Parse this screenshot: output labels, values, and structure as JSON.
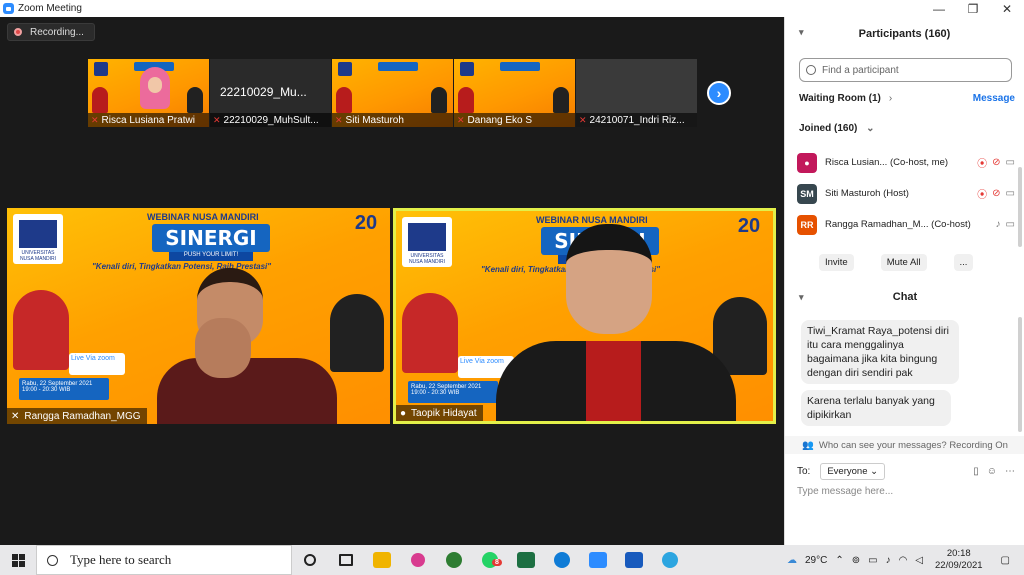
{
  "window": {
    "title": "Zoom Meeting",
    "controls": [
      "—",
      "❐",
      "✕"
    ]
  },
  "recording": {
    "label": "Recording..."
  },
  "thumbnails": [
    {
      "name": "Risca Lusiana Pratwi",
      "kind": "poster-hijab"
    },
    {
      "name": "22210029_MuhSult...",
      "kind": "plain",
      "center_text": "22210029_Mu..."
    },
    {
      "name": "Siti Masturoh",
      "kind": "poster"
    },
    {
      "name": "Danang Eko S",
      "kind": "poster"
    },
    {
      "name": "24210071_Indri Riz...",
      "kind": "dark"
    }
  ],
  "videos": [
    {
      "name": "Rangga Ramadhan_MGG"
    },
    {
      "name": "Taopik Hidayat"
    }
  ],
  "poster": {
    "webinar": "WEBINAR NUSA MANDIRI",
    "title": "SINERGI",
    "push": "PUSH YOUR LIMIT!",
    "tagline": "\"Kenali diri, Tingkatkan Potensi, Raih Prestasi\"",
    "anniv": "20",
    "live": "Live Via zoom",
    "date": "Rabu, 22 September 2021 19:00 - 20:30 WIB"
  },
  "participants_panel": {
    "title": "Participants (160)",
    "search_placeholder": "Find a participant",
    "waiting_room": "Waiting Room (1)",
    "message_label": "Message",
    "joined": "Joined (160)",
    "people": [
      {
        "initials": "",
        "name": "Risca Lusian...",
        "role": "(Co-host, me)",
        "color": "#c2185b"
      },
      {
        "initials": "SM",
        "name": "Siti Masturoh (Host)",
        "role": "",
        "color": "#37474f"
      },
      {
        "initials": "RR",
        "name": "Rangga Ramadhan_M...",
        "role": "(Co-host)",
        "color": "#e65100"
      }
    ],
    "buttons": {
      "invite": "Invite",
      "mute_all": "Mute All",
      "more": "..."
    }
  },
  "chat": {
    "title": "Chat",
    "messages": [
      "Tiwi_Kramat Raya_potensi diri itu cara menggalinya bagaimana jika kita bingung dengan diri sendiri pak",
      "Karena terlalu banyak yang dipikirkan"
    ],
    "visibility": "Who can see your messages? Recording On",
    "to_label": "To:",
    "recipient": "Everyone",
    "placeholder": "Type message here..."
  },
  "taskbar": {
    "search_placeholder": "Type here to search",
    "weather": "29°C",
    "time": "20:18",
    "date": "22/09/2021",
    "badge": "8",
    "app_colors": [
      "#f0b400",
      "#d83b8f",
      "#2e7d32",
      "#25d366",
      "#1d6f42",
      "#0f7bd6",
      "#2d8cff",
      "#185abd",
      "#2ca5e0"
    ]
  }
}
